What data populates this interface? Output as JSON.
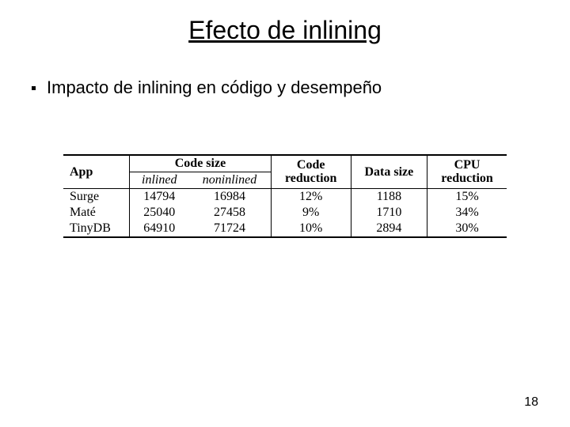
{
  "title": "Efecto de inlining",
  "bullet": "Impacto de inlining en código y desempeño",
  "page_number": "18",
  "table": {
    "headers": {
      "app": "App",
      "code_size": "Code size",
      "code_reduction": "Code\nreduction",
      "data_size": "Data size",
      "cpu_reduction": "CPU\nreduction"
    },
    "subheaders": {
      "inlined": "inlined",
      "noninlined": "noninlined"
    },
    "rows": [
      {
        "app": "Surge",
        "inlined": "14794",
        "noninlined": "16984",
        "code_reduction": "12%",
        "data_size": "1188",
        "cpu_reduction": "15%"
      },
      {
        "app": "Maté",
        "inlined": "25040",
        "noninlined": "27458",
        "code_reduction": "9%",
        "data_size": "1710",
        "cpu_reduction": "34%"
      },
      {
        "app": "TinyDB",
        "inlined": "64910",
        "noninlined": "71724",
        "code_reduction": "10%",
        "data_size": "2894",
        "cpu_reduction": "30%"
      }
    ]
  },
  "chart_data": {
    "type": "table",
    "title": "Efecto de inlining",
    "columns": [
      "App",
      "Code size (inlined)",
      "Code size (noninlined)",
      "Code reduction",
      "Data size",
      "CPU reduction"
    ],
    "rows": [
      [
        "Surge",
        14794,
        16984,
        "12%",
        1188,
        "15%"
      ],
      [
        "Maté",
        25040,
        27458,
        "9%",
        1710,
        "34%"
      ],
      [
        "TinyDB",
        64910,
        71724,
        "10%",
        2894,
        "30%"
      ]
    ]
  }
}
